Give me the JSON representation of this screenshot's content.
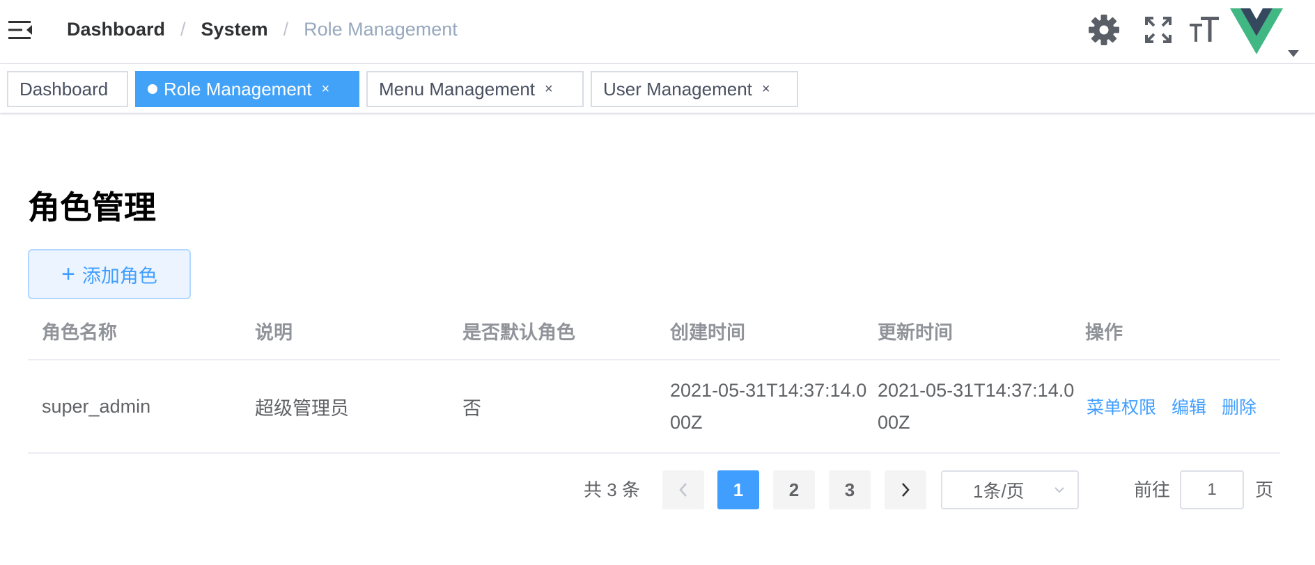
{
  "navbar": {
    "breadcrumb": [
      "Dashboard",
      "System",
      "Role Management"
    ],
    "icons": [
      "menu-fold-icon",
      "gear-icon",
      "fullscreen-icon",
      "font-size-icon",
      "vue-logo-avatar",
      "caret-down-icon"
    ],
    "colors": {
      "vue_green": "#41b883",
      "vue_dark": "#34495e",
      "icon_gray": "#5a5e66"
    }
  },
  "tags": [
    {
      "label": "Dashboard",
      "active": false,
      "closable": false
    },
    {
      "label": "Role Management",
      "active": true,
      "closable": true
    },
    {
      "label": "Menu Management",
      "active": false,
      "closable": true
    },
    {
      "label": "User Management",
      "active": false,
      "closable": true
    }
  ],
  "tag_close_glyph": "×",
  "page": {
    "title": "角色管理",
    "add_button": "添加角色",
    "add_button_icon": "+"
  },
  "table": {
    "columns": [
      "角色名称",
      "说明",
      "是否默认角色",
      "创建时间",
      "更新时间",
      "操作"
    ],
    "rows": [
      {
        "name": "super_admin",
        "description": "超级管理员",
        "is_default": "否",
        "created_at": "2021-05-31T14:37:14.000Z",
        "updated_at": "2021-05-31T14:37:14.000Z",
        "actions": [
          "菜单权限",
          "编辑",
          "删除"
        ]
      }
    ]
  },
  "pagination": {
    "total_text": "共 3 条",
    "pages": [
      "1",
      "2",
      "3"
    ],
    "current_page": "1",
    "page_size": "1条/页",
    "jump_prefix": "前往",
    "jump_value": "1",
    "jump_suffix": "页"
  },
  "colors": {
    "primary": "#409eff",
    "active_tag": "#42a2f8",
    "header_text": "#909399",
    "body_text": "#606266"
  }
}
